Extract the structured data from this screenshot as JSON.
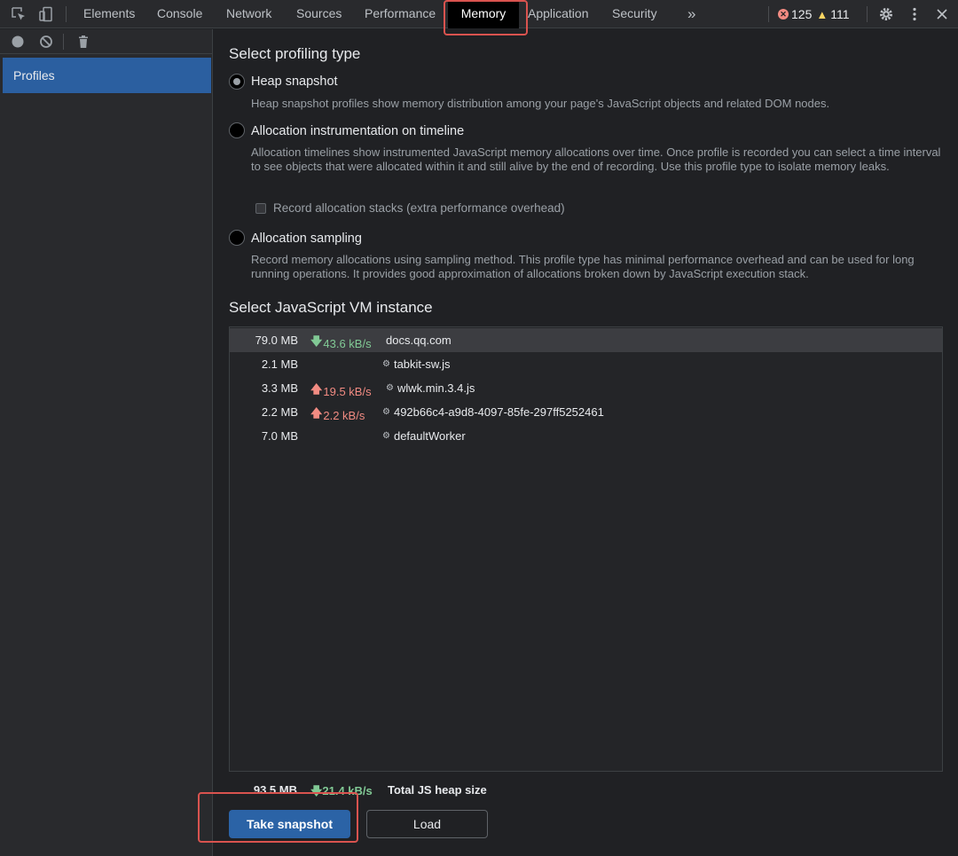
{
  "toolbar": {
    "tabs": [
      "Elements",
      "Console",
      "Network",
      "Sources",
      "Performance",
      "Memory",
      "Application",
      "Security"
    ],
    "more": "»",
    "error_count": "125",
    "warning_count": "111",
    "active_tab": "Memory",
    "highlight_color": "#d9534f"
  },
  "sidebar": {
    "profiles_label": "Profiles"
  },
  "profiling": {
    "heading": "Select profiling type",
    "options": [
      {
        "label": "Heap snapshot",
        "selected": true,
        "description": "Heap snapshot profiles show memory distribution among your page's JavaScript objects and related DOM nodes."
      },
      {
        "label": "Allocation instrumentation on timeline",
        "selected": false,
        "description": "Allocation timelines show instrumented JavaScript memory allocations over time. Once profile is recorded you can select a time interval to see objects that were allocated within it and still alive by the end of recording. Use this profile type to isolate memory leaks."
      },
      {
        "label": "Allocation sampling",
        "selected": false,
        "description": "Record memory allocations using sampling method. This profile type has minimal performance overhead and can be used for long running operations. It provides good approximation of allocations broken down by JavaScript execution stack."
      }
    ],
    "record_stacks_label": "Record allocation stacks (extra performance overhead)",
    "record_stacks_checked": false
  },
  "vm": {
    "heading": "Select JavaScript VM instance",
    "instances": [
      {
        "size": "79.0 MB",
        "rate": "43.6 kB/s",
        "direction": "down",
        "name": "docs.qq.com",
        "worker": false
      },
      {
        "size": "2.1 MB",
        "rate": "",
        "direction": "",
        "name": "tabkit-sw.js",
        "worker": true
      },
      {
        "size": "3.3 MB",
        "rate": "19.5 kB/s",
        "direction": "up",
        "name": "wlwk.min.3.4.js",
        "worker": true
      },
      {
        "size": "2.2 MB",
        "rate": "2.2 kB/s",
        "direction": "up",
        "name": "492b66c4-a9d8-4097-85fe-297ff5252461",
        "worker": true
      },
      {
        "size": "7.0 MB",
        "rate": "",
        "direction": "",
        "name": "defaultWorker",
        "worker": true
      }
    ],
    "total_size": "93.5 MB",
    "total_rate": "21.4 kB/s",
    "total_label": "Total JS heap size"
  },
  "actions": {
    "take_snapshot": "Take snapshot",
    "load": "Load"
  }
}
